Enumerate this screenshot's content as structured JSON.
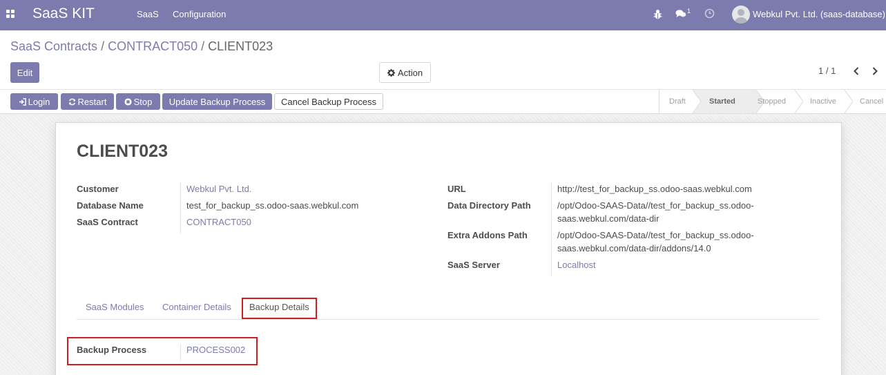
{
  "navbar": {
    "brand": "SaaS KIT",
    "menus": [
      "SaaS",
      "Configuration"
    ],
    "chat_count": "1",
    "user": "Webkul Pvt. Ltd. (saas-database)",
    "icons": [
      "apps-icon",
      "bug-icon",
      "chat-icon",
      "clock-icon",
      "avatar"
    ]
  },
  "breadcrumb": {
    "items": [
      "SaaS Contracts",
      "CONTRACT050"
    ],
    "current": "CLIENT023"
  },
  "control": {
    "edit": "Edit",
    "action": "Action",
    "pager": "1 / 1"
  },
  "buttons": {
    "login": "Login",
    "restart": "Restart",
    "stop": "Stop",
    "update_backup": "Update Backup Process",
    "cancel_backup": "Cancel Backup Process"
  },
  "stages": {
    "items": [
      "Draft",
      "Started",
      "Stopped",
      "Inactive",
      "Cancel"
    ],
    "current": "Started"
  },
  "record": {
    "title": "CLIENT023",
    "left": {
      "customer_label": "Customer",
      "customer": "Webkul Pvt. Ltd.",
      "dbname_label": "Database Name",
      "dbname": "test_for_backup_ss.odoo-saas.webkul.com",
      "contract_label": "SaaS Contract",
      "contract": "CONTRACT050"
    },
    "right": {
      "url_label": "URL",
      "url": "http://test_for_backup_ss.odoo-saas.webkul.com",
      "datadir_label": "Data Directory Path",
      "datadir_l1": "/opt/Odoo-SAAS-Data//test_for_backup_ss.odoo-",
      "datadir_l2": "saas.webkul.com/data-dir",
      "addons_label": "Extra Addons Path",
      "addons_l1": "/opt/Odoo-SAAS-Data//test_for_backup_ss.odoo-",
      "addons_l2": "saas.webkul.com/data-dir/addons/14.0",
      "server_label": "SaaS Server",
      "server": "Localhost"
    },
    "tabs": [
      "SaaS Modules",
      "Container Details",
      "Backup Details"
    ],
    "active_tab": "Backup Details",
    "backup": {
      "label": "Backup Process",
      "value": "PROCESS002"
    }
  },
  "colors": {
    "brand": "#7c7bad",
    "highlight": "#cc1f1f"
  }
}
